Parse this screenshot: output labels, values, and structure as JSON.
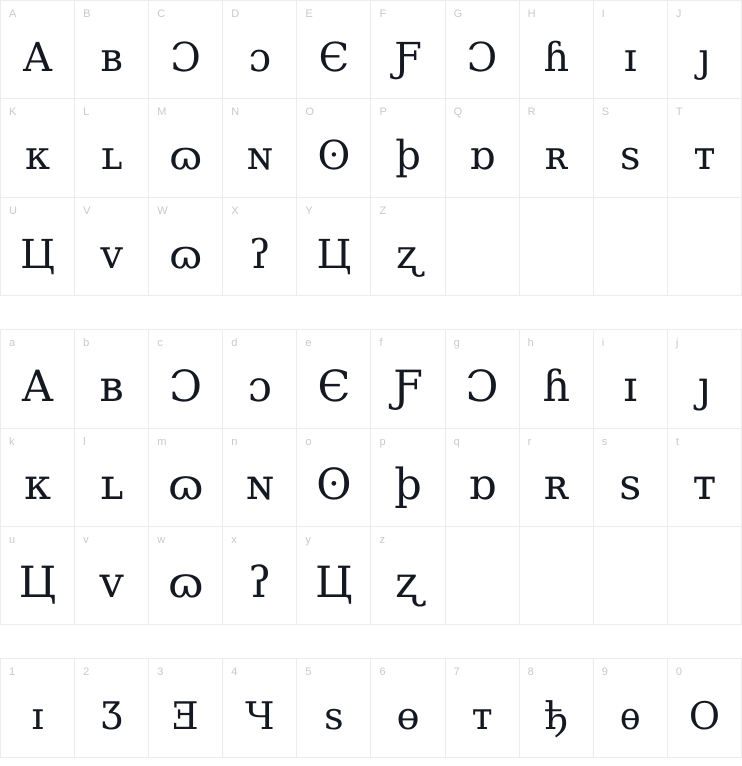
{
  "page": {
    "kind": "font-character-map",
    "background_color": "#ffffff",
    "grid_line_color": "#ececec",
    "label_color": "#c9c9c9",
    "glyph_color": "#141821",
    "columns": 10
  },
  "sections": [
    {
      "name": "uppercase",
      "cells": [
        {
          "label": "A",
          "glyph": "A"
        },
        {
          "label": "B",
          "glyph": "ʙ"
        },
        {
          "label": "C",
          "glyph": "Ɔ"
        },
        {
          "label": "D",
          "glyph": "ɔ"
        },
        {
          "label": "E",
          "glyph": "Є"
        },
        {
          "label": "F",
          "glyph": "Ƒ"
        },
        {
          "label": "G",
          "glyph": "Ɔ"
        },
        {
          "label": "H",
          "glyph": "ɦ"
        },
        {
          "label": "I",
          "glyph": "ɪ"
        },
        {
          "label": "J",
          "glyph": "ȷ"
        },
        {
          "label": "K",
          "glyph": "ᴋ"
        },
        {
          "label": "L",
          "glyph": "ʟ"
        },
        {
          "label": "M",
          "glyph": "ɷ"
        },
        {
          "label": "N",
          "glyph": "ɴ"
        },
        {
          "label": "O",
          "glyph": "ʘ"
        },
        {
          "label": "P",
          "glyph": "þ"
        },
        {
          "label": "Q",
          "glyph": "ɒ"
        },
        {
          "label": "R",
          "glyph": "ʀ"
        },
        {
          "label": "S",
          "glyph": "ѕ"
        },
        {
          "label": "T",
          "glyph": "ᴛ"
        },
        {
          "label": "U",
          "glyph": "Ц"
        },
        {
          "label": "V",
          "glyph": "ᴠ"
        },
        {
          "label": "W",
          "glyph": "ɷ"
        },
        {
          "label": "X",
          "glyph": "ʔ"
        },
        {
          "label": "Y",
          "glyph": "Ц"
        },
        {
          "label": "Z",
          "glyph": "ʐ"
        },
        {
          "label": "",
          "glyph": ""
        },
        {
          "label": "",
          "glyph": ""
        },
        {
          "label": "",
          "glyph": ""
        },
        {
          "label": "",
          "glyph": ""
        }
      ]
    },
    {
      "name": "lowercase",
      "cells": [
        {
          "label": "a",
          "glyph": "A"
        },
        {
          "label": "b",
          "glyph": "ʙ"
        },
        {
          "label": "c",
          "glyph": "Ɔ"
        },
        {
          "label": "d",
          "glyph": "ɔ"
        },
        {
          "label": "e",
          "glyph": "Є"
        },
        {
          "label": "f",
          "glyph": "Ƒ"
        },
        {
          "label": "g",
          "glyph": "Ɔ"
        },
        {
          "label": "h",
          "glyph": "ɦ"
        },
        {
          "label": "i",
          "glyph": "ɪ"
        },
        {
          "label": "j",
          "glyph": "ȷ"
        },
        {
          "label": "k",
          "glyph": "ᴋ"
        },
        {
          "label": "l",
          "glyph": "ʟ"
        },
        {
          "label": "m",
          "glyph": "ɷ"
        },
        {
          "label": "n",
          "glyph": "ɴ"
        },
        {
          "label": "o",
          "glyph": "ʘ"
        },
        {
          "label": "p",
          "glyph": "þ"
        },
        {
          "label": "q",
          "glyph": "ɒ"
        },
        {
          "label": "r",
          "glyph": "ʀ"
        },
        {
          "label": "s",
          "glyph": "ѕ"
        },
        {
          "label": "t",
          "glyph": "ᴛ"
        },
        {
          "label": "u",
          "glyph": "Ц"
        },
        {
          "label": "v",
          "glyph": "ᴠ"
        },
        {
          "label": "w",
          "glyph": "ɷ"
        },
        {
          "label": "x",
          "glyph": "ʔ"
        },
        {
          "label": "y",
          "glyph": "Ц"
        },
        {
          "label": "z",
          "glyph": "ʐ"
        },
        {
          "label": "",
          "glyph": ""
        },
        {
          "label": "",
          "glyph": ""
        },
        {
          "label": "",
          "glyph": ""
        },
        {
          "label": "",
          "glyph": ""
        }
      ]
    },
    {
      "name": "digits",
      "cells": [
        {
          "label": "1",
          "glyph": "ɪ"
        },
        {
          "label": "2",
          "glyph": "Ʒ"
        },
        {
          "label": "3",
          "glyph": "Ǝ"
        },
        {
          "label": "4",
          "glyph": "Ч"
        },
        {
          "label": "5",
          "glyph": "ѕ"
        },
        {
          "label": "6",
          "glyph": "ө"
        },
        {
          "label": "7",
          "glyph": "ᴛ"
        },
        {
          "label": "8",
          "glyph": "ђ"
        },
        {
          "label": "9",
          "glyph": "ѳ"
        },
        {
          "label": "0",
          "glyph": "О"
        }
      ]
    }
  ]
}
